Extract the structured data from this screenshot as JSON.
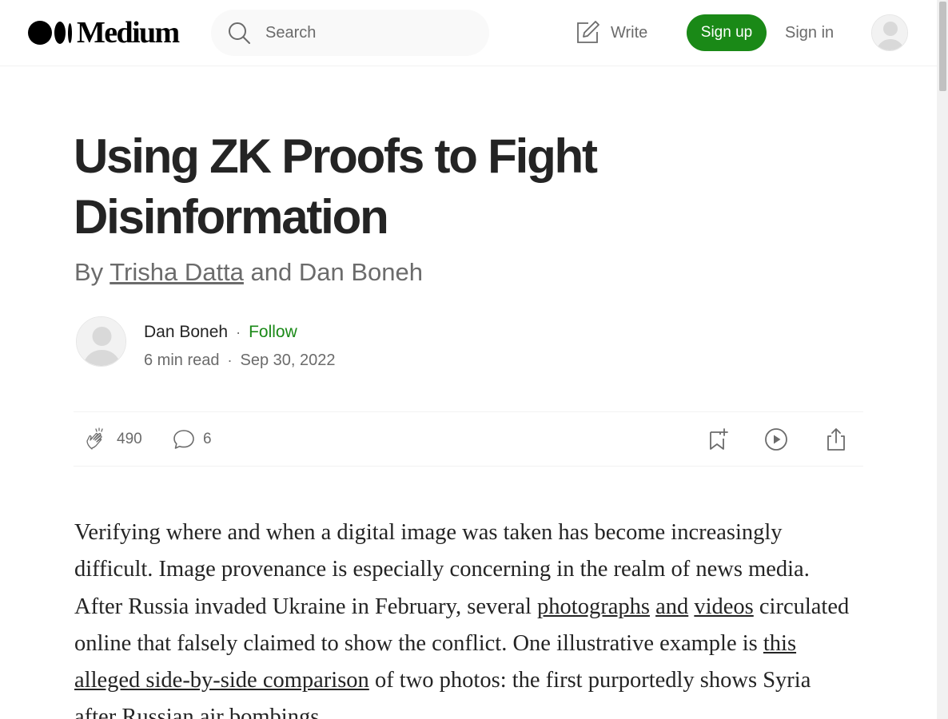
{
  "header": {
    "logo_text": "Medium",
    "search_placeholder": "Search",
    "write_label": "Write",
    "signup_label": "Sign up",
    "signin_label": "Sign in"
  },
  "article": {
    "title": "Using ZK Proofs to Fight Disinformation",
    "subtitle": {
      "prefix": "By ",
      "author1": "Trisha Datta",
      "middle": " and Dan Boneh"
    },
    "author": {
      "name": "Dan Boneh",
      "separator": "·",
      "follow_label": "Follow"
    },
    "meta": {
      "read_time": "6 min read",
      "separator": "·",
      "date": "Sep 30, 2022"
    },
    "actions": {
      "claps": "490",
      "responses": "6"
    },
    "body": {
      "p1_a": "Verifying where and when a digital image was taken has become increasingly difficult. Image provenance is especially concerning in the realm of news media. After Russia invaded Ukraine in February, several ",
      "link_photographs": "photographs",
      "space1": " ",
      "link_and": "and",
      "space2": " ",
      "link_videos": "videos",
      "p1_b": " circulated online that falsely claimed to show the conflict. One illustrative example is ",
      "link_comparison": "this alleged side-by-side comparison",
      "p1_c": " of two photos: the first purportedly shows Syria after Russian air bombings"
    }
  }
}
